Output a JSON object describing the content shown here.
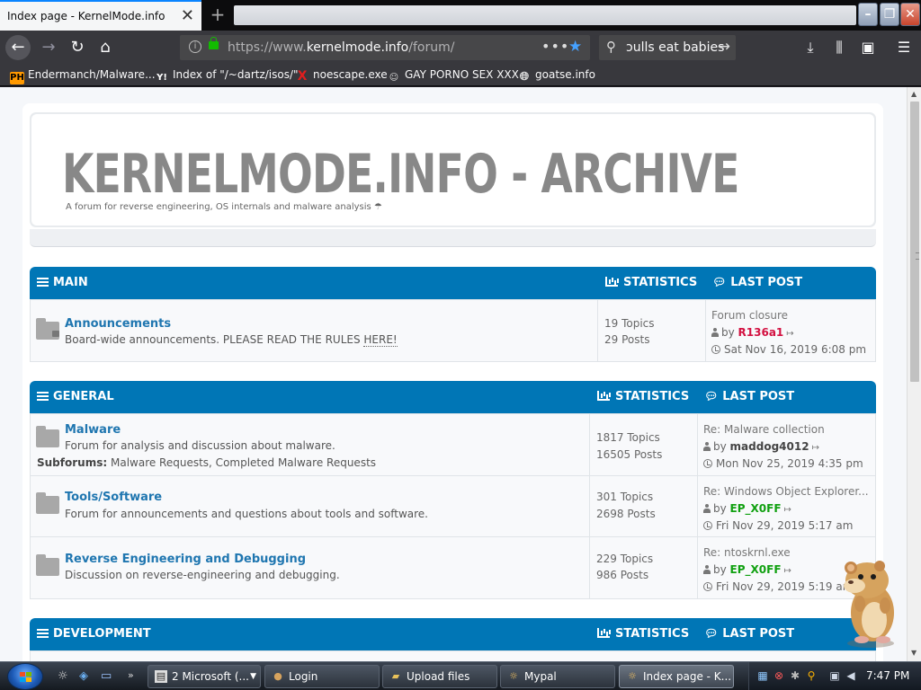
{
  "browser": {
    "tab": {
      "title": "Index page - KernelMode.info"
    },
    "url": {
      "prefix": "https://www.",
      "domain": "kernelmode.info",
      "path": "/forum/"
    },
    "search": {
      "value": "ɔulls eat babies"
    }
  },
  "bookmarks": [
    {
      "label": "Endermanch/Malware...",
      "icon": "pornhub-icon"
    },
    {
      "label": "Index of \"/~dartz/isos/\"",
      "icon": "yp-icon"
    },
    {
      "label": "noescape.exe",
      "icon": "x-icon"
    },
    {
      "label": "GAY PORNO SEX XXX",
      "icon": "mask-icon"
    },
    {
      "label": "goatse.info",
      "icon": "globe-icon"
    }
  ],
  "site": {
    "title": "KERNELMODE.INFO - ARCHIVE",
    "subtitle": "A forum for reverse engineering, OS internals and malware analysis ☂"
  },
  "headers": {
    "statistics": "STATISTICS",
    "last_post": "LAST POST",
    "by": "by",
    "subforums_label": "Subforums:"
  },
  "categories": [
    {
      "name": "MAIN",
      "forums": [
        {
          "title": "Announcements",
          "desc_prefix": "Board-wide announcements. PLEASE READ THE RULES ",
          "desc_link": "HERE!",
          "topics": "19 Topics",
          "posts": "29 Posts",
          "last_title": "Forum closure",
          "last_user": "R136a1",
          "last_date": "Sat Nov 16, 2019 6:08 pm"
        }
      ]
    },
    {
      "name": "GENERAL",
      "forums": [
        {
          "title": "Malware",
          "desc": "Forum for analysis and discussion about malware.",
          "subforums": "Malware Requests, Completed Malware Requests",
          "topics": "1817 Topics",
          "posts": "16505 Posts",
          "last_title": "Re: Malware collection",
          "last_user": "maddog4012",
          "last_date": "Mon Nov 25, 2019 4:35 pm"
        },
        {
          "title": "Tools/Software",
          "desc": "Forum for announcements and questions about tools and software.",
          "topics": "301 Topics",
          "posts": "2698 Posts",
          "last_title": "Re: Windows Object Explorer...",
          "last_user": "EP_X0FF",
          "last_date": "Fri Nov 29, 2019 5:17 am"
        },
        {
          "title": "Reverse Engineering and Debugging",
          "desc": "Discussion on reverse-engineering and debugging.",
          "topics": "229 Topics",
          "posts": "986 Posts",
          "last_title": "Re: ntoskrnl.exe",
          "last_user": "EP_X0FF",
          "last_date": "Fri Nov 29, 2019 5:19 am"
        }
      ]
    },
    {
      "name": "DEVELOPMENT",
      "forums": []
    }
  ],
  "colors": {
    "category_bar": "#0076b6",
    "admin_user": "#d31141",
    "mod_user": "#10a010",
    "link": "#1f76b0"
  },
  "taskbar": {
    "windows": [
      {
        "label": "2 Microsoft (...",
        "icon": "window-icon"
      },
      {
        "label": "Login",
        "icon": "hamster-icon"
      },
      {
        "label": "Upload files",
        "icon": "folder-icon"
      },
      {
        "label": "Mypal",
        "icon": "mypal-icon"
      },
      {
        "label": "Index page - K...",
        "icon": "mypal-icon"
      }
    ],
    "clock": "7:47 PM"
  }
}
